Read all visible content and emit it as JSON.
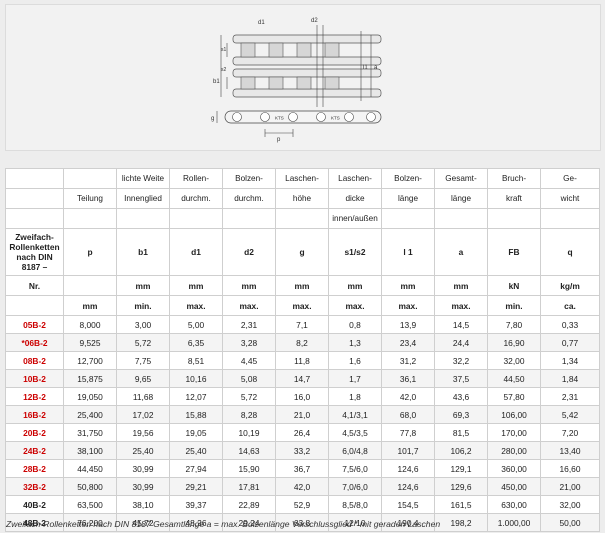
{
  "drawing": {
    "labels": {
      "d1": "d1",
      "d2": "d2",
      "b1": "b1",
      "p": "p",
      "a": "a",
      "l1": "l1",
      "g": "g",
      "s1": "s1",
      "s2": "s2",
      "brand": "KTS"
    }
  },
  "table": {
    "header_rows": [
      [
        "",
        "",
        "lichte Weite",
        "Rollen-",
        "Bolzen-",
        "Laschen-",
        "Laschen-",
        "Bolzen-",
        "Gesamt-",
        "Bruch-",
        "Ge-"
      ],
      [
        "",
        "Teilung",
        "Innenglied",
        "durchm.",
        "durchm.",
        "höhe",
        "dicke",
        "länge",
        "länge",
        "kraft",
        "wicht"
      ],
      [
        "",
        "",
        "",
        "",
        "",
        "",
        "innen/außen",
        "",
        "",
        "",
        ""
      ]
    ],
    "symbol_row": [
      "Zweifach-Rollenketten nach DIN 8187 –",
      "p",
      "b1",
      "d1",
      "d2",
      "g",
      "s1/s2",
      "l 1",
      "a",
      "FB",
      "q"
    ],
    "unit_row_1": [
      "Nr.",
      "",
      "mm",
      "mm",
      "mm",
      "mm",
      "mm",
      "mm",
      "mm",
      "kN",
      "kg/m"
    ],
    "unit_row_2": [
      "",
      "mm",
      "min.",
      "max.",
      "max.",
      "max.",
      "max.",
      "max.",
      "max.",
      "min.",
      "ca."
    ],
    "rows": [
      [
        "05B-2",
        "8,000",
        "3,00",
        "5,00",
        "2,31",
        "7,1",
        "0,8",
        "13,9",
        "14,5",
        "7,80",
        "0,33"
      ],
      [
        "*06B-2",
        "9,525",
        "5,72",
        "6,35",
        "3,28",
        "8,2",
        "1,3",
        "23,4",
        "24,4",
        "16,90",
        "0,77"
      ],
      [
        "08B-2",
        "12,700",
        "7,75",
        "8,51",
        "4,45",
        "11,8",
        "1,6",
        "31,2",
        "32,2",
        "32,00",
        "1,34"
      ],
      [
        "10B-2",
        "15,875",
        "9,65",
        "10,16",
        "5,08",
        "14,7",
        "1,7",
        "36,1",
        "37,5",
        "44,50",
        "1,84"
      ],
      [
        "12B-2",
        "19,050",
        "11,68",
        "12,07",
        "5,72",
        "16,0",
        "1,8",
        "42,0",
        "43,6",
        "57,80",
        "2,31"
      ],
      [
        "16B-2",
        "25,400",
        "17,02",
        "15,88",
        "8,28",
        "21,0",
        "4,1/3,1",
        "68,0",
        "69,3",
        "106,00",
        "5,42"
      ],
      [
        "20B-2",
        "31,750",
        "19,56",
        "19,05",
        "10,19",
        "26,4",
        "4,5/3,5",
        "77,8",
        "81,5",
        "170,00",
        "7,20"
      ],
      [
        "24B-2",
        "38,100",
        "25,40",
        "25,40",
        "14,63",
        "33,2",
        "6,0/4,8",
        "101,7",
        "106,2",
        "280,00",
        "13,40"
      ],
      [
        "28B-2",
        "44,450",
        "30,99",
        "27,94",
        "15,90",
        "36,7",
        "7,5/6,0",
        "124,6",
        "129,1",
        "360,00",
        "16,60"
      ],
      [
        "32B-2",
        "50,800",
        "30,99",
        "29,21",
        "17,81",
        "42,0",
        "7,0/6,0",
        "124,6",
        "129,6",
        "450,00",
        "21,00"
      ],
      [
        "40B-2",
        "63,500",
        "38,10",
        "39,37",
        "22,89",
        "52,9",
        "8,5/8,0",
        "154,5",
        "161,5",
        "630,00",
        "32,00"
      ],
      [
        "48B-2",
        "76,200",
        "45,72",
        "48,26",
        "29,24",
        "63,8",
        "12/10",
        "190,4",
        "198,2",
        "1.000,00",
        "50,00"
      ]
    ],
    "black_nr": [
      "40B-2",
      "48B-2"
    ]
  },
  "caption": "Zweifach-Rollenketten nach DIN 8187 Gesamtlänge a = max. Bolzenlänge Verschlussglied * mit geraden Laschen"
}
